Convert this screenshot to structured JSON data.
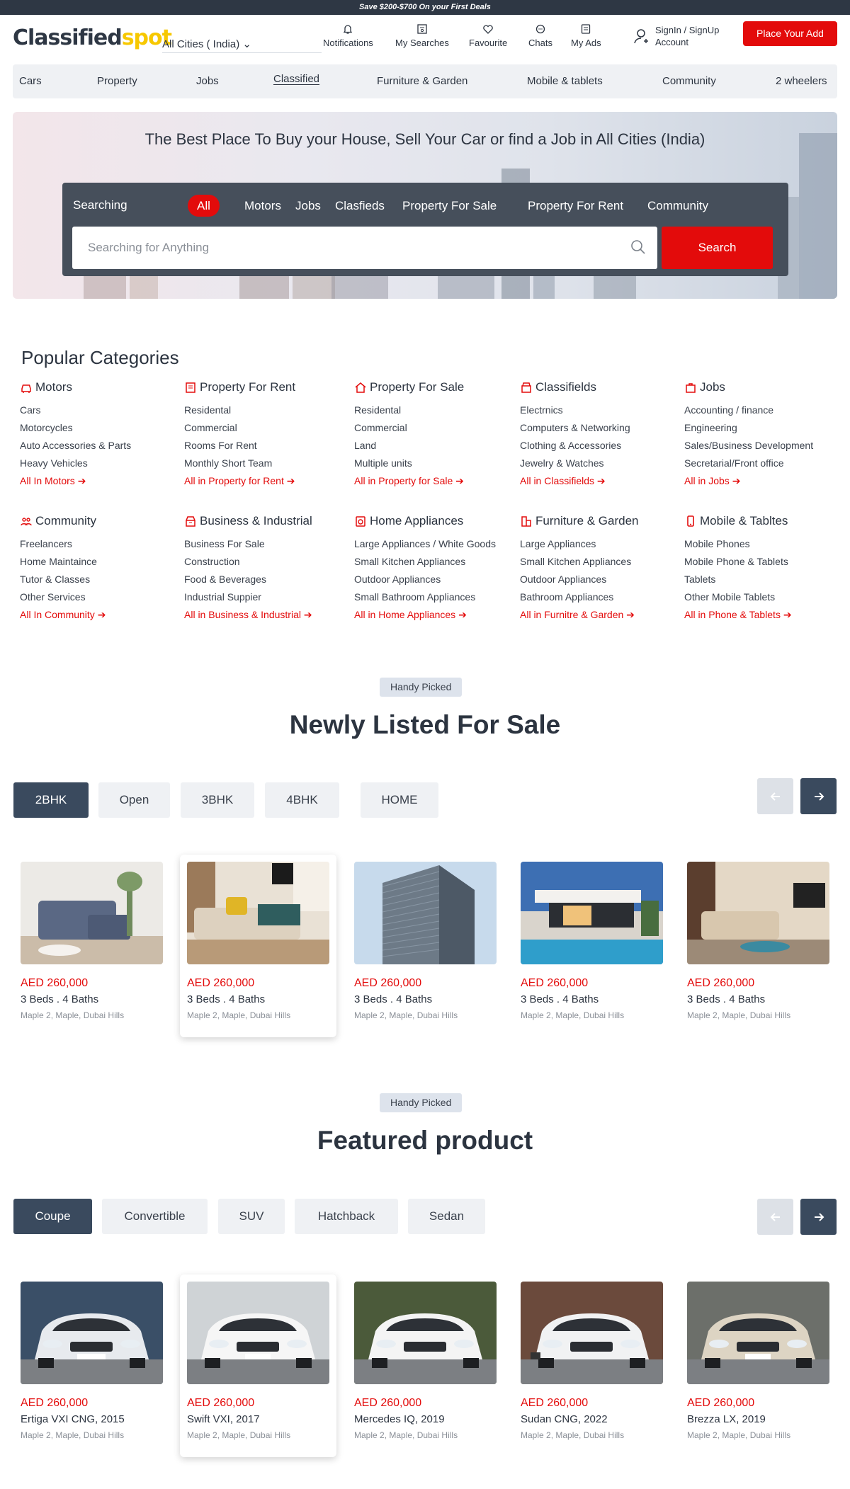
{
  "promo": {
    "text": "Save $200-$700 On your First Deals"
  },
  "header": {
    "logo_a": "Classified",
    "logo_b": "spot",
    "city": "All Cities ( India) ⌄",
    "nav": [
      {
        "label": "Notifications",
        "icon": "bell-icon"
      },
      {
        "label": "My Searches",
        "icon": "searches-icon"
      },
      {
        "label": "Favourite",
        "icon": "heart-icon"
      },
      {
        "label": "Chats",
        "icon": "chat-icon"
      },
      {
        "label": "My Ads",
        "icon": "ads-icon"
      }
    ],
    "account_line1": "SignIn / SignUp",
    "account_line2": "Account",
    "place_ad": "Place Your Add"
  },
  "catnav": [
    "Cars",
    "Property",
    "Jobs",
    "Classified",
    "Furniture & Garden",
    "Mobile & tablets",
    "Community",
    "2 wheelers"
  ],
  "hero": {
    "title": "The Best Place To Buy your House, Sell Your Car or find a Job in All Cities (India)",
    "searching_label": "Searching",
    "tabs": [
      "All",
      "Motors",
      "Jobs",
      "Clasfieds",
      "Property For Sale",
      "Property For Rent",
      "Community"
    ],
    "placeholder": "Searching for Anything",
    "search_button": "Search"
  },
  "popular": {
    "title": "Popular Categories",
    "columns": [
      {
        "title": "Motors",
        "icon": "car-icon",
        "items": [
          "Cars",
          "Motorcycles",
          "Auto Accessories & Parts",
          "Heavy Vehicles"
        ],
        "all": "All In Motors ➔"
      },
      {
        "title": "Property For Rent",
        "icon": "building-icon",
        "items": [
          "Residental",
          "Commercial",
          "Rooms For Rent",
          "Monthly Short Team"
        ],
        "all": "All in Property for Rent ➔"
      },
      {
        "title": "Property For Sale",
        "icon": "house-icon",
        "items": [
          "Residental",
          "Commercial",
          "Land",
          "Multiple units"
        ],
        "all": "All in Property for Sale ➔"
      },
      {
        "title": "Classifields",
        "icon": "shop-icon",
        "items": [
          "Electrnics",
          "Computers & Networking",
          "Clothing & Accessories",
          "Jewelry & Watches"
        ],
        "all": "All in Classifields ➔"
      },
      {
        "title": "Jobs",
        "icon": "briefcase-icon",
        "items": [
          "Accounting / finance",
          "Engineering",
          "Sales/Business Development",
          "Secretarial/Front office"
        ],
        "all": "All in Jobs ➔"
      },
      {
        "title": "Community",
        "icon": "community-icon",
        "items": [
          "Freelancers",
          "Home Maintaince",
          "Tutor & Classes",
          "Other Services"
        ],
        "all": "All In Community ➔"
      },
      {
        "title": "Business & Industrial",
        "icon": "store-icon",
        "items": [
          "Business For Sale",
          "Construction",
          "Food & Beverages",
          "Industrial Suppier"
        ],
        "all": "All in Business & Industrial ➔"
      },
      {
        "title": "Home Appliances",
        "icon": "appliance-icon",
        "items": [
          "Large Appliances / White Goods",
          "Small Kitchen Appliances",
          "Outdoor Appliances",
          "Small Bathroom Appliances"
        ],
        "all": "All in Home Appliances ➔"
      },
      {
        "title": "Furniture & Garden",
        "icon": "furniture-icon",
        "items": [
          "Large Appliances",
          "Small Kitchen Appliances",
          "Outdoor Appliances",
          "Bathroom Appliances"
        ],
        "all": "All in Furnitre & Garden ➔"
      },
      {
        "title": "Mobile & Tabltes",
        "icon": "mobile-icon",
        "items": [
          "Mobile Phones",
          "Mobile Phone & Tablets",
          "Tablets",
          "Other Mobile Tablets"
        ],
        "all": "All in Phone & Tablets ➔"
      }
    ]
  },
  "sale": {
    "pill": "Handy Picked",
    "title": "Newly Listed For Sale",
    "tabs": [
      "2BHK",
      "Open",
      "3BHK",
      "4BHK",
      "HOME"
    ],
    "active_tab": "2BHK",
    "cards": [
      {
        "price": "AED 260,000",
        "desc": "3 Beds  .  4 Baths",
        "loc": "Maple 2, Maple, Dubai Hills"
      },
      {
        "price": "AED 260,000",
        "desc": "3 Beds  .  4 Baths",
        "loc": "Maple 2, Maple, Dubai Hills"
      },
      {
        "price": "AED 260,000",
        "desc": "3 Beds  .  4 Baths",
        "loc": "Maple 2, Maple, Dubai Hills"
      },
      {
        "price": "AED 260,000",
        "desc": "3 Beds  .  4 Baths",
        "loc": "Maple 2, Maple, Dubai Hills"
      },
      {
        "price": "AED 260,000",
        "desc": "3 Beds  .  4 Baths",
        "loc": "Maple 2, Maple, Dubai Hills"
      }
    ]
  },
  "featured": {
    "pill": "Handy Picked",
    "title": "Featured product",
    "tabs": [
      "Coupe",
      "Convertible",
      "SUV",
      "Hatchback",
      "Sedan"
    ],
    "active_tab": "Coupe",
    "cards": [
      {
        "price": "AED 260,000",
        "desc": "Ertiga VXI CNG, 2015",
        "loc": "Maple 2, Maple, Dubai Hills"
      },
      {
        "price": "AED 260,000",
        "desc": "Swift VXI, 2017",
        "loc": "Maple 2, Maple, Dubai Hills"
      },
      {
        "price": "AED 260,000",
        "desc": "Mercedes IQ, 2019",
        "loc": "Maple 2, Maple, Dubai Hills"
      },
      {
        "price": "AED 260,000",
        "desc": "Sudan CNG, 2022",
        "loc": "Maple 2, Maple, Dubai Hills"
      },
      {
        "price": "AED 260,000",
        "desc": "Brezza LX, 2019",
        "loc": "Maple 2, Maple, Dubai Hills"
      }
    ]
  },
  "colors": {
    "brand_red": "#e30b0b",
    "dark": "#2e3744",
    "tab_active": "#3a4a5e",
    "logo_yellow": "#f7c800"
  }
}
